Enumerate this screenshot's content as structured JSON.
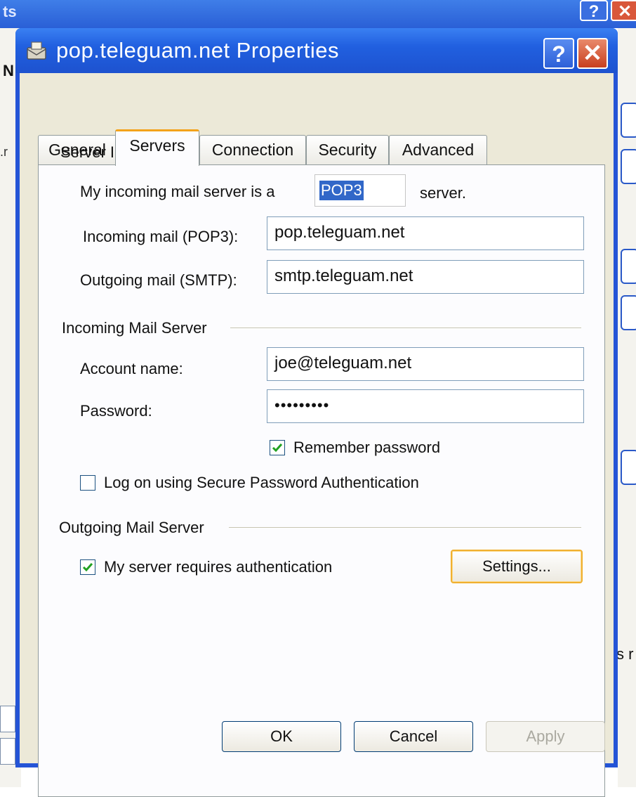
{
  "background": {
    "title_fragment": "ts",
    "left_field_text": "N",
    "left_line_text": ".r",
    "right_text": "s r"
  },
  "dialog": {
    "title": "pop.teleguam.net Properties",
    "help_label": "?",
    "close_label": "✕"
  },
  "tabs": [
    {
      "label": "General",
      "active": false
    },
    {
      "label": "Servers",
      "active": true
    },
    {
      "label": "Connection",
      "active": false
    },
    {
      "label": "Security",
      "active": false
    },
    {
      "label": "Advanced",
      "active": false
    }
  ],
  "server_info": {
    "heading": "Server Information",
    "incoming_type_prefix": "My incoming mail server is a",
    "incoming_type_value": "POP3",
    "incoming_type_suffix": "server.",
    "incoming_label": "Incoming mail (POP3):",
    "incoming_value": "pop.teleguam.net",
    "outgoing_label": "Outgoing mail (SMTP):",
    "outgoing_value": "smtp.teleguam.net"
  },
  "incoming_server": {
    "heading": "Incoming Mail Server",
    "account_label": "Account name:",
    "account_value": "joe@teleguam.net",
    "password_label": "Password:",
    "password_value": "•••••••••",
    "remember_label": "Remember password",
    "remember_checked": true,
    "spa_label": "Log on using Secure Password Authentication",
    "spa_checked": false
  },
  "outgoing_server": {
    "heading": "Outgoing Mail Server",
    "auth_label": "My server requires authentication",
    "auth_checked": true,
    "settings_label": "Settings..."
  },
  "buttons": {
    "ok": "OK",
    "cancel": "Cancel",
    "apply": "Apply"
  },
  "colors": {
    "titlebar": "#2160e0",
    "dialog_face": "#ece9d8",
    "active_tab_accent": "#f3a21a",
    "selection": "#3167c8",
    "check": "#21a121"
  }
}
